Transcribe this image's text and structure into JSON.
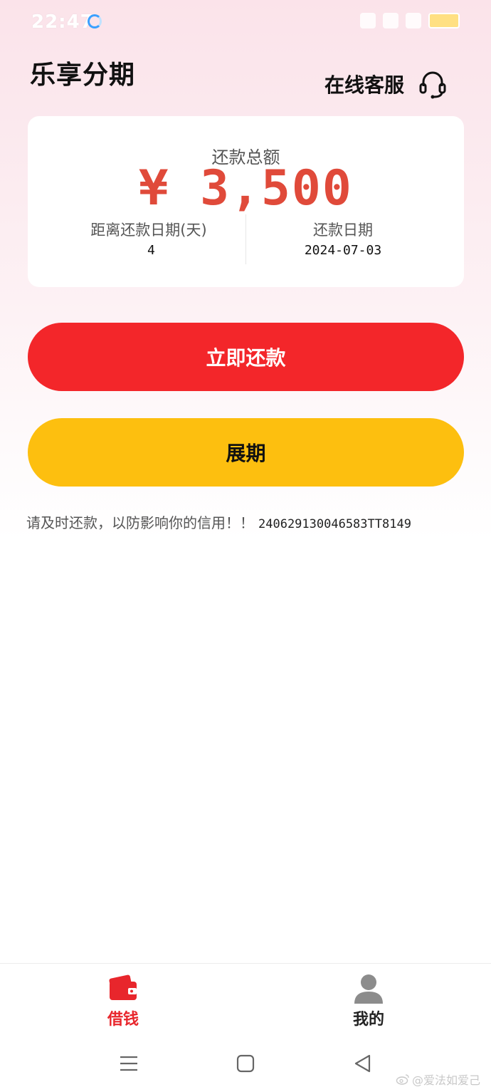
{
  "status_bar": {
    "time": "22:47"
  },
  "header": {
    "title": "乐享分期",
    "customer_service_label": "在线客服"
  },
  "summary": {
    "total_label": "还款总额",
    "total_amount": "¥ 3,500",
    "days_label": "距离还款日期(天)",
    "days_value": "4",
    "date_label": "还款日期",
    "date_value": "2024-07-03"
  },
  "actions": {
    "repay_label": "立即还款",
    "extend_label": "展期"
  },
  "notice": {
    "text": "请及时还款，以防影响你的信用！！",
    "code": "240629130046583TT8149"
  },
  "tabbar": {
    "items": [
      {
        "label": "借钱",
        "active": true,
        "icon": "wallet-icon"
      },
      {
        "label": "我的",
        "active": false,
        "icon": "user-icon"
      }
    ]
  },
  "watermark": {
    "text": "@爱法如爱己"
  },
  "colors": {
    "primary_red": "#f3262a",
    "amount_red": "#e04a3a",
    "extend_yellow": "#fdbf0f",
    "tab_active": "#e8262c"
  }
}
